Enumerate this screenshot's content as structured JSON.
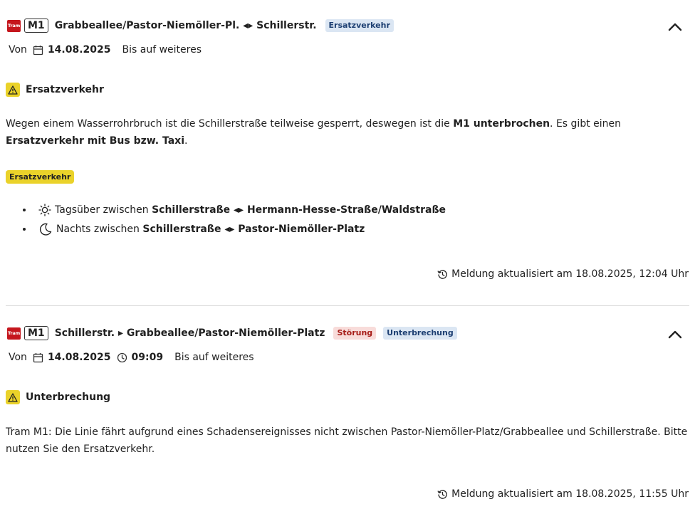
{
  "messages": [
    {
      "vehicle_icon_text": "Tram",
      "line": "M1",
      "route": "Grabbeallee/Pastor-Niemöller-Pl. ◂▸ Schillerstr.",
      "tags": [
        "Ersatzverkehr"
      ],
      "from_label": "Von",
      "from_date": "14.08.2025",
      "until_text": "Bis auf weiteres",
      "section_title": "Ersatzverkehr",
      "body": {
        "p1": "Wegen einem Wasserrohrbruch ist die Schillerstraße teilweise gesperrt, deswegen ist die ",
        "b1": "M1 unterbrochen",
        "p2": ". Es gibt einen ",
        "b2": "Ersatzverkehr mit Bus bzw. Taxi",
        "p3": "."
      },
      "highlight_tag": "Ersatzverkehr",
      "list": [
        {
          "icon": "sun-icon",
          "prefix": "Tagsüber zwischen ",
          "from": "Schillerstraße",
          "sep": " ◂▸ ",
          "to": "Hermann-Hesse-Straße/Waldstraße"
        },
        {
          "icon": "moon-icon",
          "prefix": "Nachts zwischen ",
          "from": "Schillerstraße",
          "sep": " ◂▸ ",
          "to": "Pastor-Niemöller-Platz"
        }
      ],
      "updated": "Meldung aktualisiert am 18.08.2025, 12:04 Uhr"
    },
    {
      "vehicle_icon_text": "Tram",
      "line": "M1",
      "route": "Schillerstr. ▸ Grabbeallee/Pastor-Niemöller-Platz",
      "tags": [
        "Störung",
        "Unterbrechung"
      ],
      "from_label": "Von",
      "from_date": "14.08.2025",
      "from_time": "09:09",
      "until_text": "Bis auf weiteres",
      "section_title": "Unterbrechung",
      "body_text": "Tram M1: Die Linie fährt aufgrund eines Schadensereignisses nicht zwischen Pastor-Niemöller-Platz/Grabbeallee und Schillerstraße. Bitte nutzen Sie den Ersatzverkehr.",
      "updated": "Meldung aktualisiert am 18.08.2025, 11:55 Uhr"
    }
  ],
  "colors": {
    "tram_red": "#c5161d",
    "warning_yellow": "#ead22a",
    "tag_blue_bg": "#dbe6f3",
    "tag_red_bg": "#f8dcda"
  }
}
